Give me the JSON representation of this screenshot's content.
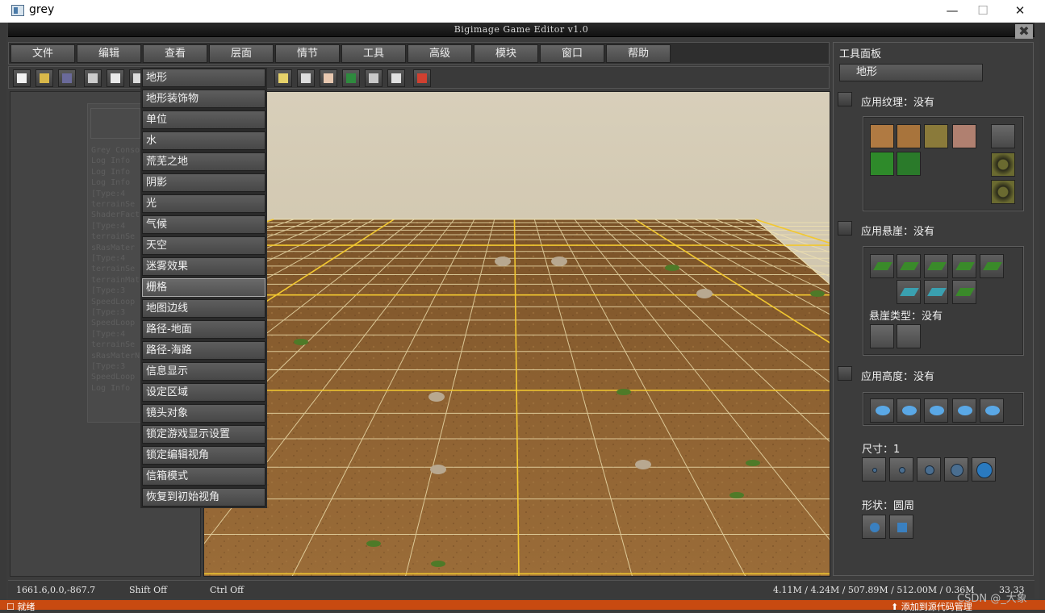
{
  "os_window": {
    "title": "grey",
    "minimize_glyph": "—",
    "maximize_glyph": "☐",
    "close_glyph": "✕"
  },
  "editor": {
    "title": "Bigimage Game Editor v1.0",
    "close_glyph": "✖"
  },
  "menubar": [
    "文件",
    "编辑",
    "查看",
    "层面",
    "情节",
    "工具",
    "高级",
    "模块",
    "窗口",
    "帮助"
  ],
  "toolbar_icons": [
    {
      "name": "new-file-icon",
      "color": "#f2f2f2"
    },
    {
      "name": "open-folder-icon",
      "color": "#d9b84a"
    },
    {
      "name": "save-icon",
      "color": "#6a6a9a"
    },
    {
      "name": "cut-icon",
      "color": "#cccccc"
    },
    {
      "name": "copy-icon",
      "color": "#e8e8e8"
    },
    {
      "name": "paste-icon",
      "color": "#dddddd"
    },
    {
      "name": "sound-icon",
      "color": "#e6d26a"
    },
    {
      "name": "camera-icon",
      "color": "#dddddd"
    },
    {
      "name": "script-icon",
      "color": "#e8c8b0"
    },
    {
      "name": "map-icon",
      "color": "#2e8a3e"
    },
    {
      "name": "object-icon",
      "color": "#c8c8c8"
    },
    {
      "name": "export-icon",
      "color": "#e0e0e0"
    },
    {
      "name": "check-icon",
      "color": "#d04030"
    }
  ],
  "dropdown": {
    "items": [
      "地形",
      "地形装饰物",
      "单位",
      "水",
      "荒芜之地",
      "阴影",
      "光",
      "气候",
      "天空",
      "迷雾效果",
      "栅格",
      "地图边线",
      "路径-地面",
      "路径-海路",
      "信息显示",
      "设定区域",
      "镜头对象",
      "锁定游戏显示设置",
      "锁定编辑视角",
      "信箱模式",
      "恢复到初始视角"
    ],
    "active_index": 10
  },
  "console_lines": [
    "Grey Consol",
    "Log Info",
    "Log Info",
    "Log Info",
    "[Type:4",
    "terrainSe",
    "ShaderFact",
    "[Type:4",
    "terrainSe",
    "sRasMater",
    "[Type:4",
    "terrainSe",
    "terrainMate",
    "[Type:3",
    "SpeedLoop",
    "[Type:3",
    "SpeedLoop",
    "[Type:4",
    "terrainSe",
    "sRasMaterN",
    "[Type:3",
    "SpeedLoop",
    "Log Info"
  ],
  "tool_panel": {
    "title": "工具面板",
    "mode_button": "地形",
    "apply_texture": "应用纹理：没有",
    "texture_swatches": [
      "#b07a42",
      "#a8743c",
      "#8a7a3a",
      "#b08070",
      "#2e8a2a",
      "#2a7a2a"
    ],
    "apply_cliff": "应用悬崖：没有",
    "cliff_type": "悬崖类型：没有",
    "apply_height": "应用高度：没有",
    "size_label": "尺寸：1",
    "shape_label": "形状：圆周"
  },
  "statusbar": {
    "coords": "1661.6,0.0,-867.7",
    "shift": "Shift Off",
    "ctrl": "Ctrl Off",
    "memory": "4.11M / 4.24M / 507.89M / 512.00M / 0.36M",
    "fps": "33.33"
  },
  "taskbar": {
    "left_text": "就绪",
    "right_text": "添加到源代码管理"
  },
  "watermark": "CSDN @_大象"
}
